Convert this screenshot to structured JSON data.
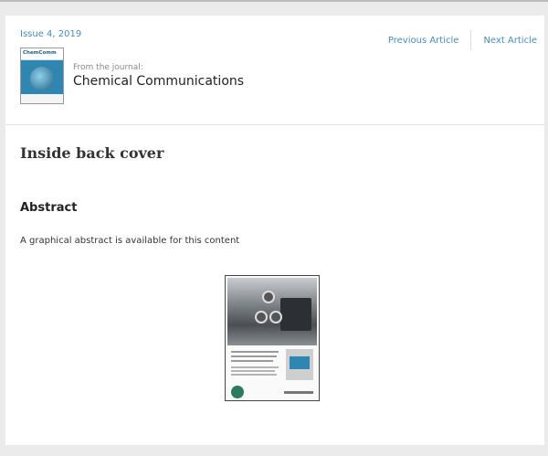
{
  "header": {
    "issue": "Issue 4, 2019",
    "nav": {
      "previous": "Previous Article",
      "next": "Next Article"
    },
    "cover_thumb_title": "ChemComm",
    "from_label": "From the journal:",
    "journal": "Chemical Communications"
  },
  "article": {
    "title": "Inside back cover",
    "abstract_heading": "Abstract",
    "abstract_text": "A graphical abstract is available for this content"
  },
  "colors": {
    "link": "#4a8cb4",
    "background": "#ebebeb",
    "card": "#ffffff"
  }
}
